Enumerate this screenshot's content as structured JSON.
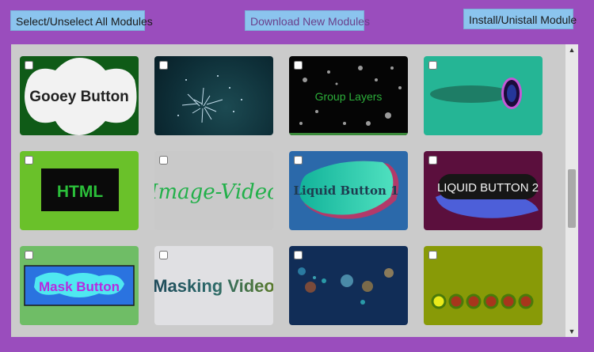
{
  "toolbar": {
    "select_all_label": "Select/Unselect All Modules",
    "download_label": "Download New Modules",
    "install_label": "Install/Unistall Module"
  },
  "modules": [
    {
      "name": "Gooey Button",
      "bg": "#0f5b17"
    },
    {
      "name": "",
      "bg": "#0e2f38"
    },
    {
      "name": "Group Layers",
      "bg": "#050505"
    },
    {
      "name": "",
      "bg": "#25b595"
    },
    {
      "name": "HTML",
      "bg": "#6ac12a"
    },
    {
      "name": "Image-Video",
      "bg": "#c9c9c9"
    },
    {
      "name": "Liquid Button 1",
      "bg": "#2b69aa"
    },
    {
      "name": "LIQUID BUTTON 2",
      "bg": "#5b0f3d"
    },
    {
      "name": "Mask Button",
      "bg": "#6fbd66"
    },
    {
      "name": "Masking Video",
      "bg": "#e0e0e3"
    },
    {
      "name": "",
      "bg": "#112d57"
    },
    {
      "name": "",
      "bg": "#889a07"
    }
  ]
}
